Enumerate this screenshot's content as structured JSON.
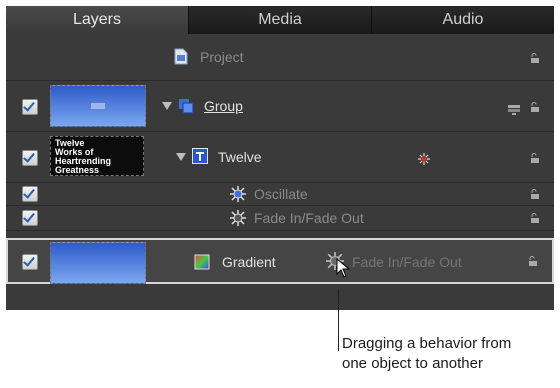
{
  "tabs": [
    {
      "label": "Layers"
    },
    {
      "label": "Media"
    },
    {
      "label": "Audio"
    }
  ],
  "project": {
    "label": "Project"
  },
  "rows": [
    {
      "label": "Group"
    },
    {
      "label": "Twelve",
      "thumb_text": "Twelve\nWorks of\nHeartrending\nGreatness"
    },
    {
      "label": "Oscillate"
    },
    {
      "label": "Fade In/Fade Out"
    },
    {
      "label": "Gradient",
      "dragged_label": "Fade In/Fade Out"
    }
  ],
  "caption": {
    "line1": "Dragging a behavior from",
    "line2": "one object to another"
  },
  "colors": {
    "panel": "#3a3a3a",
    "accent_blue": "#2f5bc9"
  }
}
